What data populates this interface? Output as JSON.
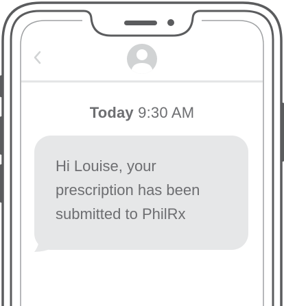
{
  "header": {
    "back_icon": "chevron-left-icon",
    "avatar_icon": "person-avatar-icon"
  },
  "conversation": {
    "timestamp_day": "Today",
    "timestamp_time": "9:30 AM",
    "messages": [
      {
        "text": "Hi Louise, your prescription has been submitted to PhilRx"
      }
    ]
  },
  "colors": {
    "frame": "#5b5c5e",
    "divider": "#e3e4e5",
    "bubble": "#e6e7e8",
    "text": "#6d6e71",
    "icon": "#d1d3d4"
  }
}
